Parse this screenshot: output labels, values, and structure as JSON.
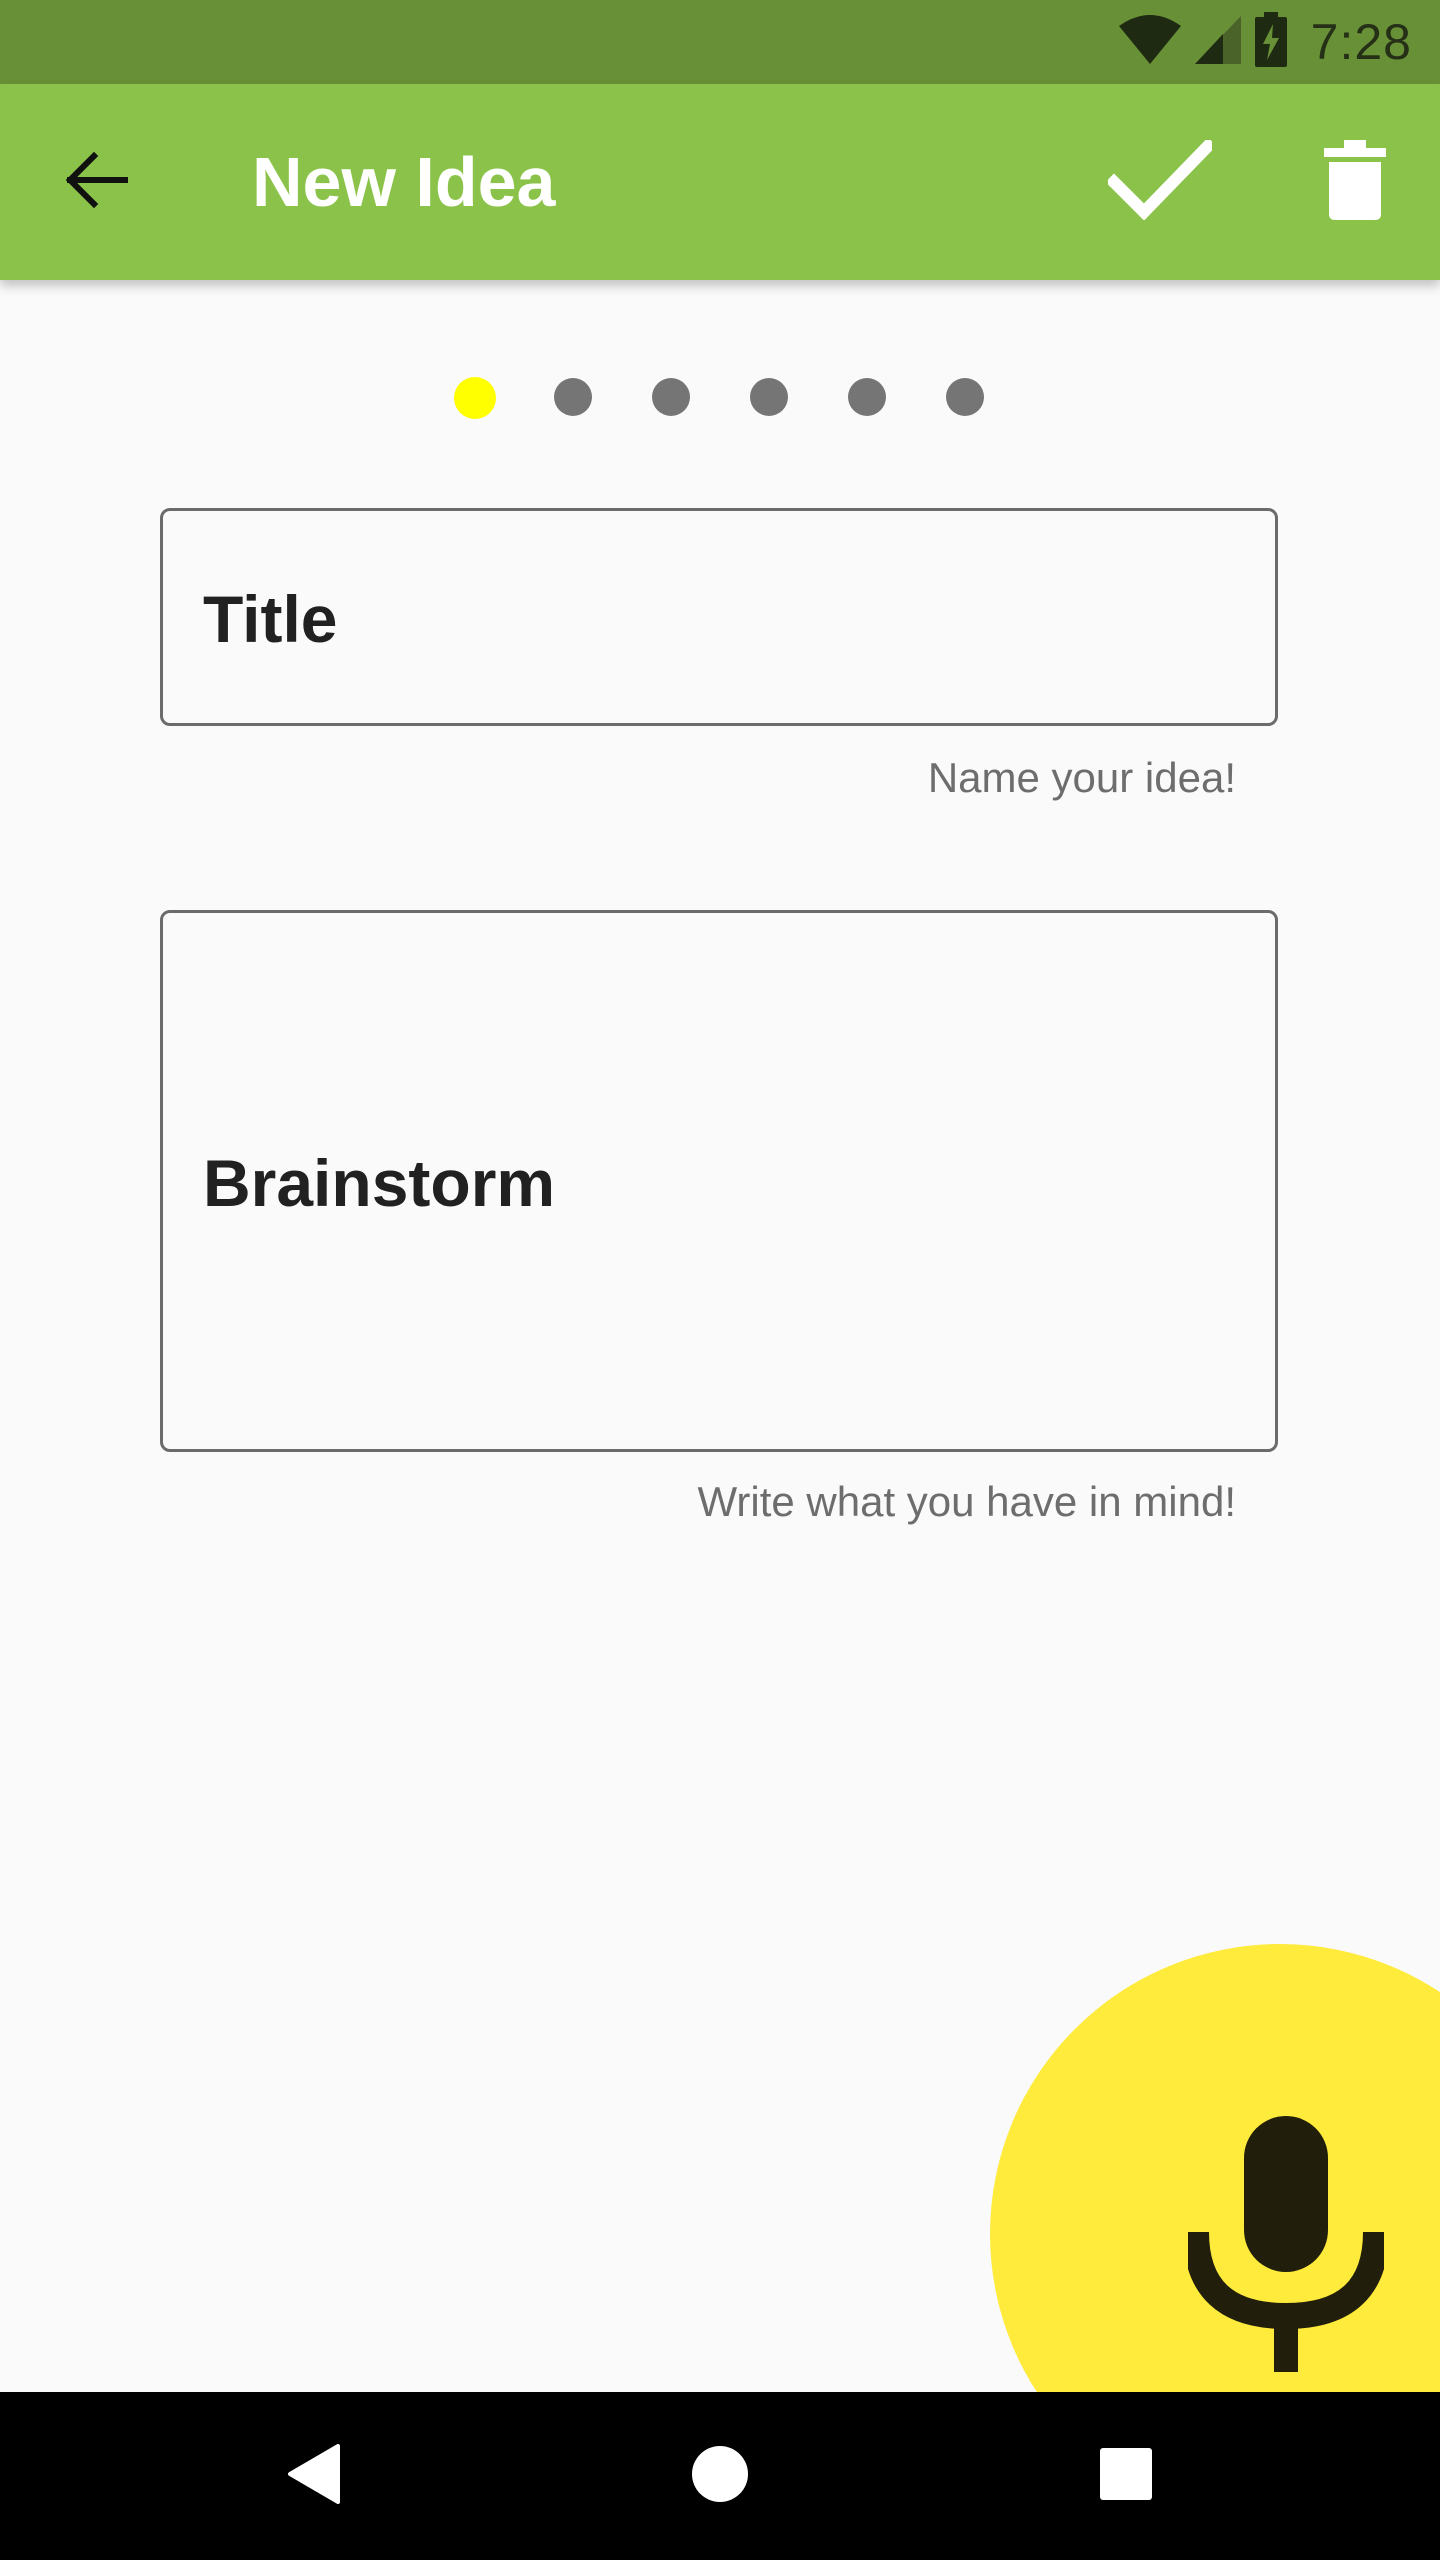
{
  "status_bar": {
    "time": "7:28",
    "icons": [
      "wifi-icon",
      "cellular-signal-icon",
      "battery-charging-icon"
    ]
  },
  "app_bar": {
    "title": "New Idea",
    "back_icon": "arrow-back-icon",
    "actions": [
      "check-icon",
      "trash-icon"
    ]
  },
  "page_indicator": {
    "total": 6,
    "active_index": 0,
    "active_color": "#FFFF00",
    "inactive_color": "#757575"
  },
  "form": {
    "title_field": {
      "value": "Title",
      "helper": "Name your idea!"
    },
    "brainstorm_field": {
      "value": "Brainstorm",
      "helper": "Write what you have in mind!"
    }
  },
  "fab": {
    "icon": "microphone-icon",
    "color": "#FFEB3B"
  },
  "nav_bar": {
    "icons": [
      "back-triangle-icon",
      "home-circle-icon",
      "recents-square-icon"
    ]
  },
  "colors": {
    "status_bar": "#689036",
    "app_bar": "#8BC34A",
    "background": "#FAFAFA"
  }
}
